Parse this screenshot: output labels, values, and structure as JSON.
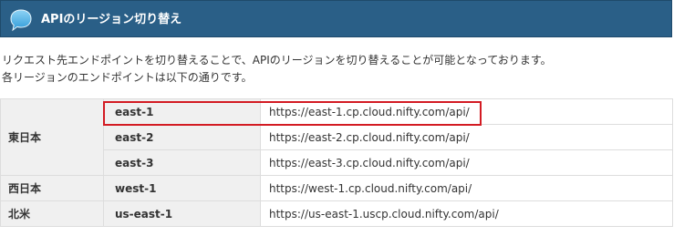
{
  "header": {
    "title": "APIのリージョン切り替え",
    "icon": "speech-bubble-icon",
    "background": "#2a5f87"
  },
  "intro": {
    "line1": "リクエスト先エンドポイントを切り替えることで、APIのリージョンを切り替えることが可能となっております。",
    "line2": "各リージョンのエンドポイントは以下の通りです。"
  },
  "table": {
    "rows": [
      {
        "area": "東日本",
        "region": "east-1",
        "endpoint": "https://east-1.cp.cloud.nifty.com/api/",
        "highlighted": true
      },
      {
        "area": "東日本",
        "region": "east-2",
        "endpoint": "https://east-2.cp.cloud.nifty.com/api/"
      },
      {
        "area": "東日本",
        "region": "east-3",
        "endpoint": "https://east-3.cp.cloud.nifty.com/api/"
      },
      {
        "area": "西日本",
        "region": "west-1",
        "endpoint": "https://west-1.cp.cloud.nifty.com/api/"
      },
      {
        "area": "北米",
        "region": "us-east-1",
        "endpoint": "https://us-east-1.uscp.cloud.nifty.com/api/"
      }
    ]
  },
  "highlight_color": "#d31b23"
}
